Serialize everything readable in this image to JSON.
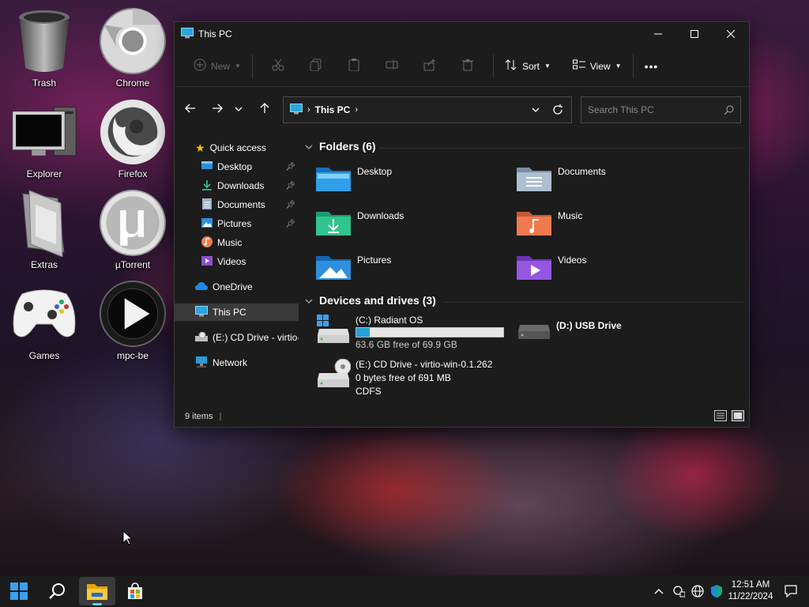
{
  "desktop": {
    "icons": [
      {
        "label": "Trash",
        "icon": "trash-icon"
      },
      {
        "label": "Chrome",
        "icon": "chrome-icon"
      },
      {
        "label": "Explorer",
        "icon": "computer-icon"
      },
      {
        "label": "Firefox",
        "icon": "firefox-icon"
      },
      {
        "label": "Extras",
        "icon": "folder-icon"
      },
      {
        "label": "µTorrent",
        "icon": "utorrent-icon"
      },
      {
        "label": "Games",
        "icon": "gamepad-icon"
      },
      {
        "label": "mpc-be",
        "icon": "play-icon"
      }
    ]
  },
  "window": {
    "title": "This PC",
    "toolbar": {
      "new_label": "New",
      "sort_label": "Sort",
      "view_label": "View",
      "more": "•••"
    },
    "address": {
      "crumb": "This PC"
    },
    "search": {
      "placeholder": "Search This PC"
    },
    "sidebar": {
      "quick_access": "Quick access",
      "items": [
        "Desktop",
        "Downloads",
        "Documents",
        "Pictures",
        "Music",
        "Videos"
      ],
      "onedrive": "OneDrive",
      "this_pc": "This PC",
      "cd_drive": "(E:) CD Drive - virtio-win-0.1.262",
      "network": "Network"
    },
    "folders_header": "Folders (6)",
    "folders": [
      "Desktop",
      "Documents",
      "Downloads",
      "Music",
      "Pictures",
      "Videos"
    ],
    "drives_header": "Devices and drives (3)",
    "drives": [
      {
        "name": "(C:) Radiant OS",
        "free": "63.6 GB free of 69.9 GB",
        "used_fraction": 0.09
      },
      {
        "name": "(D:) USB Drive"
      },
      {
        "name": "(E:) CD Drive - virtio-win-0.1.262",
        "free": "0 bytes free of 691 MB",
        "fs": "CDFS"
      }
    ],
    "status": "9 items"
  },
  "taskbar": {
    "clock_time": "12:51 AM",
    "clock_date": "11/22/2024"
  },
  "colors": {
    "accent": "#0078d4",
    "drive_bar": "#26a0da"
  }
}
